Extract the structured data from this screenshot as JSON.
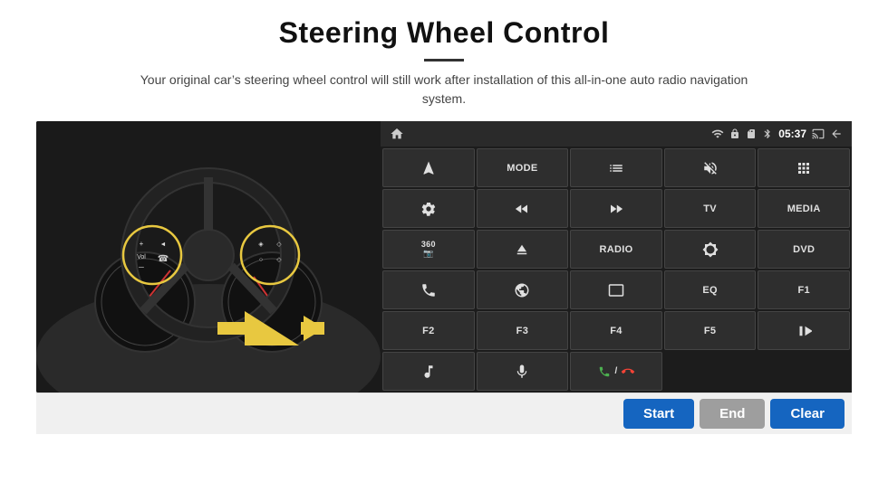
{
  "page": {
    "title": "Steering Wheel Control",
    "divider": true,
    "subtitle": "Your original car’s steering wheel control will still work after installation of this all-in-one auto radio navigation system."
  },
  "status_bar": {
    "time": "05:37",
    "icons": [
      "home",
      "wifi",
      "lock",
      "sd",
      "bluetooth",
      "signal",
      "cast",
      "back"
    ]
  },
  "grid_buttons": [
    {
      "id": "r1c1",
      "type": "icon",
      "icon": "navigate",
      "label": ""
    },
    {
      "id": "r1c2",
      "type": "text",
      "label": "MODE"
    },
    {
      "id": "r1c3",
      "type": "icon",
      "icon": "list",
      "label": ""
    },
    {
      "id": "r1c4",
      "type": "icon",
      "icon": "volume-mute",
      "label": ""
    },
    {
      "id": "r1c5",
      "type": "icon",
      "icon": "apps",
      "label": ""
    },
    {
      "id": "r2c1",
      "type": "icon",
      "icon": "settings",
      "label": ""
    },
    {
      "id": "r2c2",
      "type": "icon",
      "icon": "rewind",
      "label": ""
    },
    {
      "id": "r2c3",
      "type": "icon",
      "icon": "fast-forward",
      "label": ""
    },
    {
      "id": "r2c4",
      "type": "text",
      "label": "TV"
    },
    {
      "id": "r2c5",
      "type": "text",
      "label": "MEDIA"
    },
    {
      "id": "r3c1",
      "type": "icon",
      "icon": "360-cam",
      "label": ""
    },
    {
      "id": "r3c2",
      "type": "icon",
      "icon": "eject",
      "label": ""
    },
    {
      "id": "r3c3",
      "type": "text",
      "label": "RADIO"
    },
    {
      "id": "r3c4",
      "type": "icon",
      "icon": "brightness",
      "label": ""
    },
    {
      "id": "r3c5",
      "type": "text",
      "label": "DVD"
    },
    {
      "id": "r4c1",
      "type": "icon",
      "icon": "phone",
      "label": ""
    },
    {
      "id": "r4c2",
      "type": "icon",
      "icon": "browser",
      "label": ""
    },
    {
      "id": "r4c3",
      "type": "icon",
      "icon": "screen",
      "label": ""
    },
    {
      "id": "r4c4",
      "type": "text",
      "label": "EQ"
    },
    {
      "id": "r4c5",
      "type": "text",
      "label": "F1"
    },
    {
      "id": "r5c1",
      "type": "text",
      "label": "F2"
    },
    {
      "id": "r5c2",
      "type": "text",
      "label": "F3"
    },
    {
      "id": "r5c3",
      "type": "text",
      "label": "F4"
    },
    {
      "id": "r5c4",
      "type": "text",
      "label": "F5"
    },
    {
      "id": "r5c5",
      "type": "icon",
      "icon": "play-pause",
      "label": ""
    },
    {
      "id": "r6c1",
      "type": "icon",
      "icon": "music",
      "label": ""
    },
    {
      "id": "r6c2",
      "type": "icon",
      "icon": "mic",
      "label": ""
    },
    {
      "id": "r6c3",
      "type": "icon",
      "icon": "phone-answer",
      "label": ""
    }
  ],
  "bottom_buttons": {
    "start": "Start",
    "end": "End",
    "clear": "Clear"
  }
}
